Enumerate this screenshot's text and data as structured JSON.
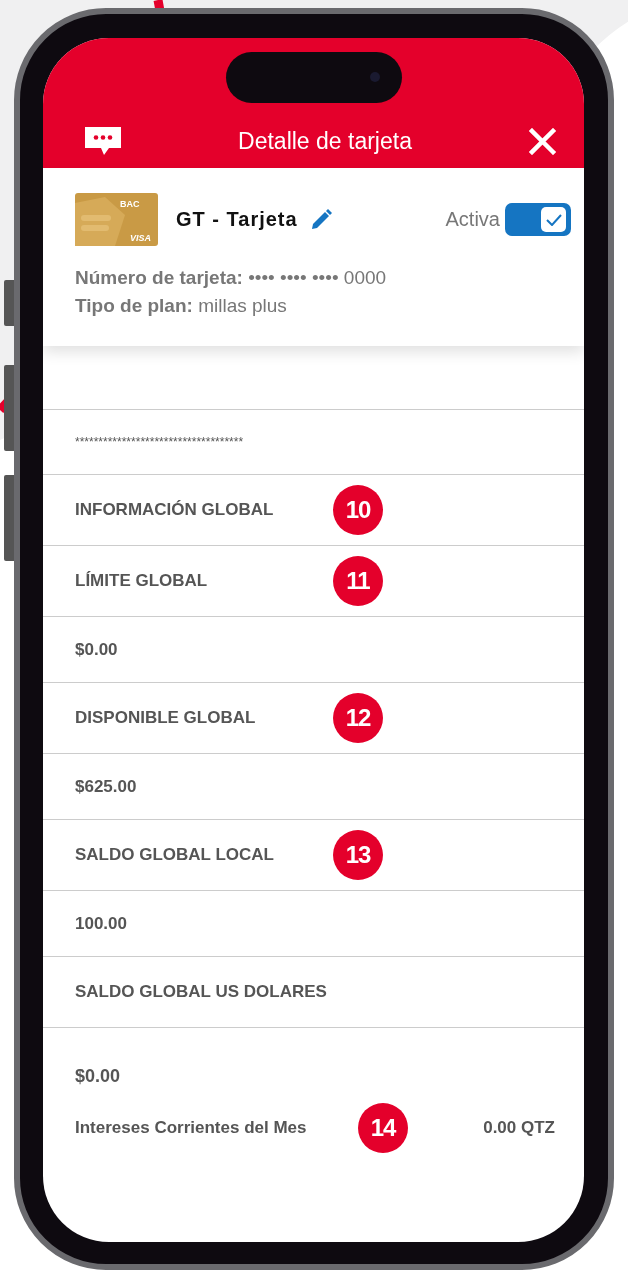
{
  "header": {
    "title": "Detalle de tarjeta"
  },
  "card": {
    "image": {
      "brand": "BAC",
      "network": "VISA"
    },
    "name": "GT - Tarjeta",
    "status_label": "Activa",
    "active": true,
    "number_label": "Número de tarjeta:",
    "number_value": "•••• •••• •••• 0000",
    "plan_label": "Tipo de plan:",
    "plan_value": "millas plus"
  },
  "masked": "************************************",
  "rows": [
    {
      "kind": "heading",
      "text": "INFORMACIÓN GLOBAL",
      "badge": "10"
    },
    {
      "kind": "heading",
      "text": "LÍMITE GLOBAL",
      "badge": "11"
    },
    {
      "kind": "value",
      "text": "$0.00"
    },
    {
      "kind": "heading",
      "text": "DISPONIBLE GLOBAL",
      "badge": "12"
    },
    {
      "kind": "value",
      "text": "$625.00"
    },
    {
      "kind": "heading",
      "text": "SALDO GLOBAL LOCAL",
      "badge": "13"
    },
    {
      "kind": "value",
      "text": "100.00"
    },
    {
      "kind": "heading",
      "text": "SALDO GLOBAL US DOLARES"
    }
  ],
  "balance": "$0.00",
  "interest": {
    "label": "Intereses Corrientes del Mes",
    "badge": "14",
    "value": "0.00 QTZ"
  }
}
